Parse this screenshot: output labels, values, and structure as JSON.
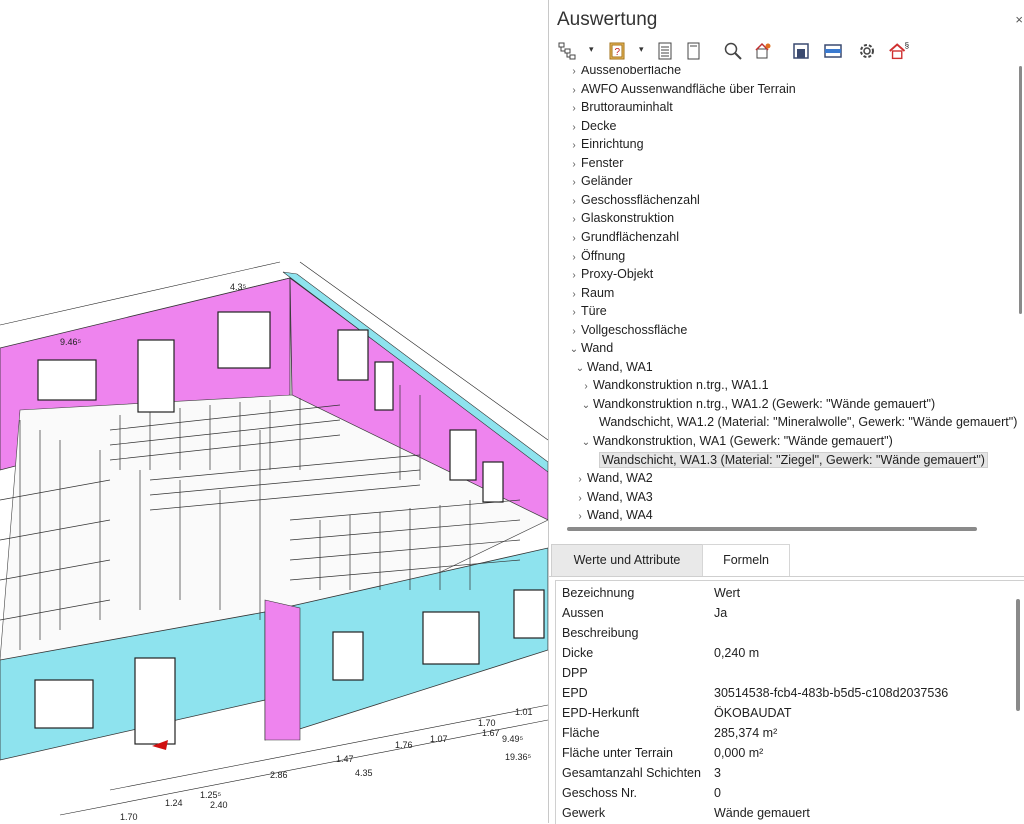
{
  "panel": {
    "title": "Auswertung",
    "close": "×",
    "toolbar": [
      {
        "icon": "hierarchy-icon"
      },
      {
        "icon": "help-book-icon"
      },
      {
        "icon": "report-list-icon"
      },
      {
        "icon": "document-icon"
      },
      {
        "icon": "search-icon"
      },
      {
        "icon": "house-settings-icon"
      },
      {
        "icon": "window-element-icon"
      },
      {
        "icon": "layer-icon"
      },
      {
        "icon": "gear-icon"
      },
      {
        "icon": "house-paragraph-icon"
      }
    ],
    "dropdown_glyph": "▾"
  },
  "tree": {
    "items": [
      {
        "label": "Aussenoberfläche",
        "expanded": false
      },
      {
        "label": "AWFO Aussenwandfläche über Terrain",
        "expanded": false
      },
      {
        "label": "Bruttorauminhalt",
        "expanded": false
      },
      {
        "label": "Decke",
        "expanded": false
      },
      {
        "label": "Einrichtung",
        "expanded": false
      },
      {
        "label": "Fenster",
        "expanded": false
      },
      {
        "label": "Geländer",
        "expanded": false
      },
      {
        "label": "Geschossflächenzahl",
        "expanded": false
      },
      {
        "label": "Glaskonstruktion",
        "expanded": false
      },
      {
        "label": "Grundflächenzahl",
        "expanded": false
      },
      {
        "label": "Öffnung",
        "expanded": false
      },
      {
        "label": "Proxy-Objekt",
        "expanded": false
      },
      {
        "label": "Raum",
        "expanded": false
      },
      {
        "label": "Türe",
        "expanded": false
      },
      {
        "label": "Vollgeschossfläche",
        "expanded": false
      },
      {
        "label": "Wand",
        "expanded": true
      },
      {
        "label": "Wand, WA1",
        "expanded": true
      },
      {
        "label": "Wandkonstruktion n.trg., WA1.1",
        "expanded": false
      },
      {
        "label": "Wandkonstruktion n.trg., WA1.2 (Gewerk: \"Wände gemauert\")",
        "expanded": true
      },
      {
        "label": "Wandschicht, WA1.2 (Material: \"Mineralwolle\", Gewerk: \"Wände gemauert\")",
        "expanded": false
      },
      {
        "label": "Wandkonstruktion, WA1 (Gewerk: \"Wände gemauert\")",
        "expanded": true
      },
      {
        "label": "Wandschicht, WA1.3 (Material: \"Ziegel\", Gewerk: \"Wände gemauert\")",
        "expanded": false,
        "selected": true
      },
      {
        "label": "Wand, WA2",
        "expanded": false
      },
      {
        "label": "Wand, WA3",
        "expanded": false
      },
      {
        "label": "Wand, WA4",
        "expanded": false
      }
    ]
  },
  "tabs": [
    {
      "label": "Werte und Attribute",
      "active": true
    },
    {
      "label": "Formeln",
      "active": false
    }
  ],
  "attributes": {
    "header": {
      "name": "Bezeichnung",
      "value": "Wert"
    },
    "rows": [
      {
        "name": "Aussen",
        "value": "Ja"
      },
      {
        "name": "Beschreibung",
        "value": ""
      },
      {
        "name": "Dicke",
        "value": "0,240 m"
      },
      {
        "name": "DPP",
        "value": ""
      },
      {
        "name": "EPD",
        "value": "30514538-fcb4-483b-b5d5-c108d2037536"
      },
      {
        "name": "EPD-Herkunft",
        "value": "ÖKOBAUDAT"
      },
      {
        "name": "Fläche",
        "value": "285,374 m²"
      },
      {
        "name": "Fläche unter Terrain",
        "value": "0,000 m²"
      },
      {
        "name": "Gesamtanzahl Schichten",
        "value": "3"
      },
      {
        "name": "Geschoss Nr.",
        "value": "0"
      },
      {
        "name": "Gewerk",
        "value": "Wände gemauert"
      }
    ]
  },
  "model": {
    "colors": {
      "wall_highlight": "#ee84ee",
      "wall_outer": "#8ee3ee",
      "line": "#222222",
      "marker": "#d01010"
    },
    "dimensions": [
      "9.46⁵",
      "2.86",
      "1.24",
      "1.25⁵",
      "2.40",
      "1.47",
      "1.76",
      "1.07",
      "1.70",
      "1.67",
      "9.49⁵",
      "19.36⁵",
      "4.35",
      "1.70",
      "1.01",
      "4.3⁵"
    ]
  }
}
